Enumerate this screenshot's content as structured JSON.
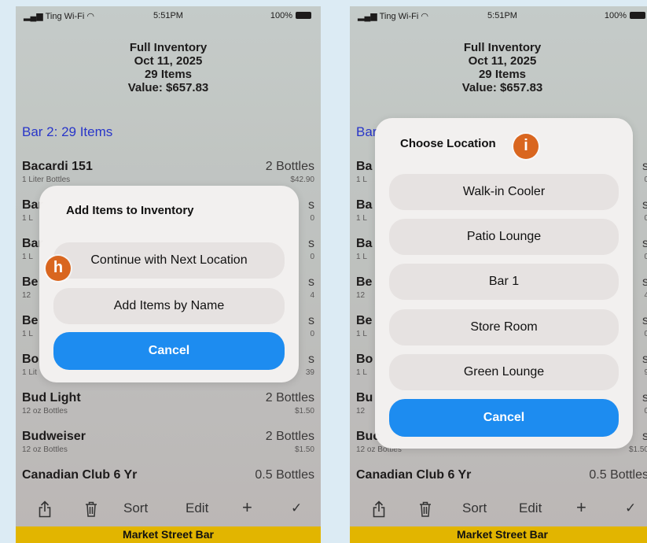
{
  "status": {
    "carrier": "Ting Wi-Fi",
    "time": "5:51PM",
    "battery": "100%"
  },
  "header": {
    "title": "Full Inventory",
    "date": "Oct 11, 2025",
    "count": "29 Items",
    "value": "Value: $657.83"
  },
  "location_title": "Bar 2:  29 Items",
  "left_items": [
    {
      "name": "Bacardi 151",
      "sub": "1 Liter Bottles",
      "qty": "2 Bottles",
      "price": "$42.90"
    },
    {
      "name": "Bar",
      "sub": "1 L",
      "qty": "s",
      "price": "0"
    },
    {
      "name": "Bar",
      "sub": "1 L",
      "qty": "s",
      "price": "0"
    },
    {
      "name": "Be",
      "sub": "12",
      "qty": "s",
      "price": "4"
    },
    {
      "name": "Be",
      "sub": "1 L",
      "qty": "s",
      "price": "0"
    },
    {
      "name": "Bo",
      "sub": "1 Lit",
      "qty": "s",
      "price": "39"
    },
    {
      "name": "Bud Light",
      "sub": "12 oz Bottles",
      "qty": "2 Bottles",
      "price": "$1.50"
    },
    {
      "name": "Budweiser",
      "sub": "12 oz Bottles",
      "qty": "2 Bottles",
      "price": "$1.50"
    },
    {
      "name": "Canadian Club 6 Yr",
      "sub": "",
      "qty": "0.5 Bottles",
      "price": ""
    }
  ],
  "right_items": [
    {
      "name": "Ba",
      "sub": "1 L",
      "qty": "s",
      "price": "0"
    },
    {
      "name": "Ba",
      "sub": "1 L",
      "qty": "s",
      "price": "0"
    },
    {
      "name": "Ba",
      "sub": "1 L",
      "qty": "s",
      "price": "0"
    },
    {
      "name": "Be",
      "sub": "12",
      "qty": "s",
      "price": "4"
    },
    {
      "name": "Be",
      "sub": "1 L",
      "qty": "s",
      "price": "0"
    },
    {
      "name": "Bo",
      "sub": "1 L",
      "qty": "s",
      "price": "9"
    },
    {
      "name": "Bu",
      "sub": "12",
      "qty": "s",
      "price": "0"
    },
    {
      "name": "Buc",
      "sub": "12 oz Bottles",
      "qty": "s",
      "price": "$1.50"
    },
    {
      "name": "Canadian Club 6 Yr",
      "sub": "",
      "qty": "0.5 Bottles",
      "price": ""
    }
  ],
  "right_location_title": "Bar",
  "toolbar": {
    "share_icon": "share-icon",
    "trash_icon": "trash-icon",
    "sort": "Sort",
    "edit": "Edit",
    "add": "+",
    "done": "✓"
  },
  "footer": "Market Street Bar",
  "add_sheet": {
    "title": "Add Items to Inventory",
    "continue": "Continue with Next Location",
    "by_name": "Add Items by Name",
    "cancel": "Cancel",
    "badge": "h"
  },
  "location_sheet": {
    "title": "Choose Location",
    "badge": "i",
    "options": [
      "Walk-in Cooler",
      "Patio Lounge",
      "Bar 1",
      "Store Room",
      "Green Lounge"
    ],
    "cancel": "Cancel"
  },
  "colors": {
    "accent": "#1d8cf0",
    "badge": "#d9661f",
    "footer": "#e2b500",
    "location_title": "#1e2fd6"
  }
}
